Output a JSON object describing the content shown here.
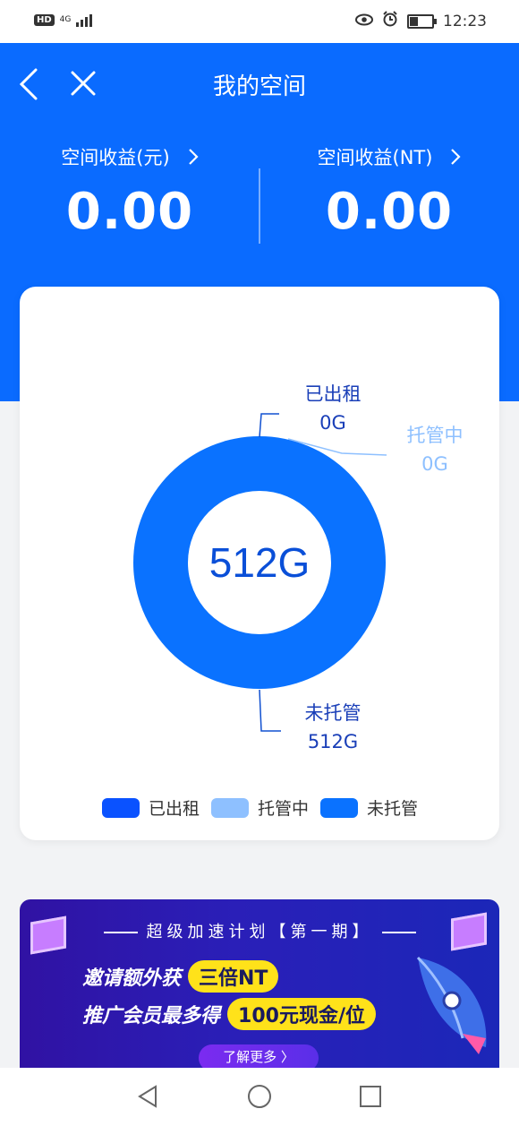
{
  "status_bar": {
    "hd": "HD",
    "network": "4G",
    "time": "12:23"
  },
  "header": {
    "title": "我的空间",
    "stats": [
      {
        "label": "空间收益(元)",
        "value": "0.00"
      },
      {
        "label": "空间收益(NT)",
        "value": "0.00"
      }
    ]
  },
  "chart_data": {
    "type": "pie",
    "center_label": "512G",
    "slices": [
      {
        "name": "已出租",
        "value": 0,
        "display": "0G",
        "color": "#0a52ff"
      },
      {
        "name": "托管中",
        "value": 0,
        "display": "0G",
        "color": "#8ec0ff"
      },
      {
        "name": "未托管",
        "value": 512,
        "display": "512G",
        "color": "#0a72ff"
      }
    ],
    "legend": [
      "已出租",
      "托管中",
      "未托管"
    ],
    "legend_position": "bottom"
  },
  "banner": {
    "title": "超级加速计划【第一期】",
    "line1_text": "邀请额外获",
    "line1_highlight": "三倍NT",
    "line2_text": "推广会员最多得",
    "line2_highlight": "100元现金/位",
    "more_button": "了解更多 〉"
  },
  "icons": {
    "back": "chevron-left-icon",
    "close": "close-icon",
    "nav_back": "triangle-back-icon",
    "nav_home": "circle-home-icon",
    "nav_recent": "square-recent-icon"
  },
  "colors": {
    "primary": "#0a6bff",
    "rented": "#0a52ff",
    "hosting": "#8ec0ff",
    "unhosted": "#0a72ff"
  }
}
